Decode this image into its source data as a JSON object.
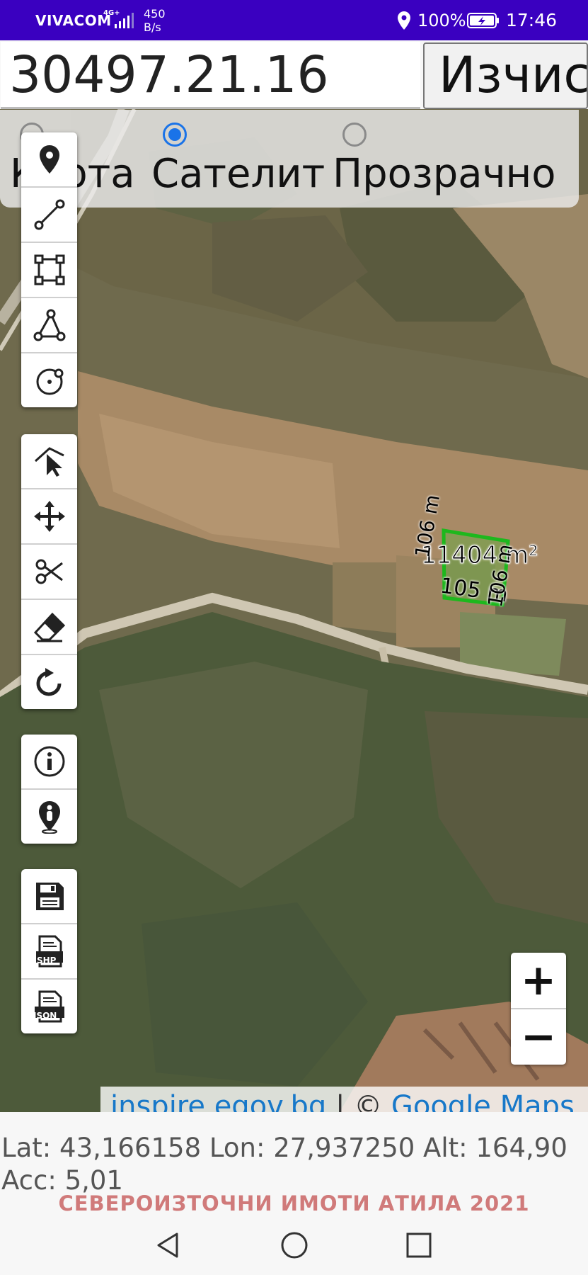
{
  "status_bar": {
    "carrier": "VIVACOM",
    "network": "4G+",
    "speed_value": "450",
    "speed_unit": "B/s",
    "battery": "100%",
    "time": "17:46"
  },
  "top": {
    "cadastral_id": "30497.21.16",
    "calc_button": "Изчис"
  },
  "map_type": {
    "options": [
      "Карта",
      "Сателит",
      "Прозрачно"
    ],
    "selected": "Сателит"
  },
  "toolbar": {
    "group1": [
      "marker-icon",
      "line-icon",
      "polygon-icon",
      "angle-icon",
      "circle-icon"
    ],
    "group2": [
      "edit-vertex-icon",
      "move-icon",
      "cut-icon",
      "eraser-icon",
      "rotate-icon"
    ],
    "group3": [
      "info-icon",
      "my-location-icon"
    ],
    "group4": [
      "save-icon",
      "shp-icon",
      "json-icon"
    ],
    "shp_label": "SHP",
    "json_label": "JSON"
  },
  "parcel": {
    "area": "11404 m²",
    "side_left": "106 m",
    "side_bottom": "105 m",
    "side_right": "106 m",
    "highlight_color": "#22cc22"
  },
  "zoom": {
    "in": "+",
    "out": "−"
  },
  "attribution": {
    "source": "inspire.egov.bg",
    "separator": " | © ",
    "provider": "Google Maps"
  },
  "coordinates": {
    "lat_label": "Lat:",
    "lat": "43,166158",
    "lon_label": "Lon:",
    "lon": "27,937250",
    "alt_label": "Alt:",
    "alt": "164,90",
    "acc_label": "Acc:",
    "acc": "5,01"
  },
  "footer_title": "СЕВЕРОИЗТОЧНИ ИМОТИ АТИЛА 2021",
  "colors": {
    "status_bar": "#3a00c0",
    "radio_selected": "#1a73e8",
    "link": "#1778c9",
    "footer": "#d07a7a"
  }
}
